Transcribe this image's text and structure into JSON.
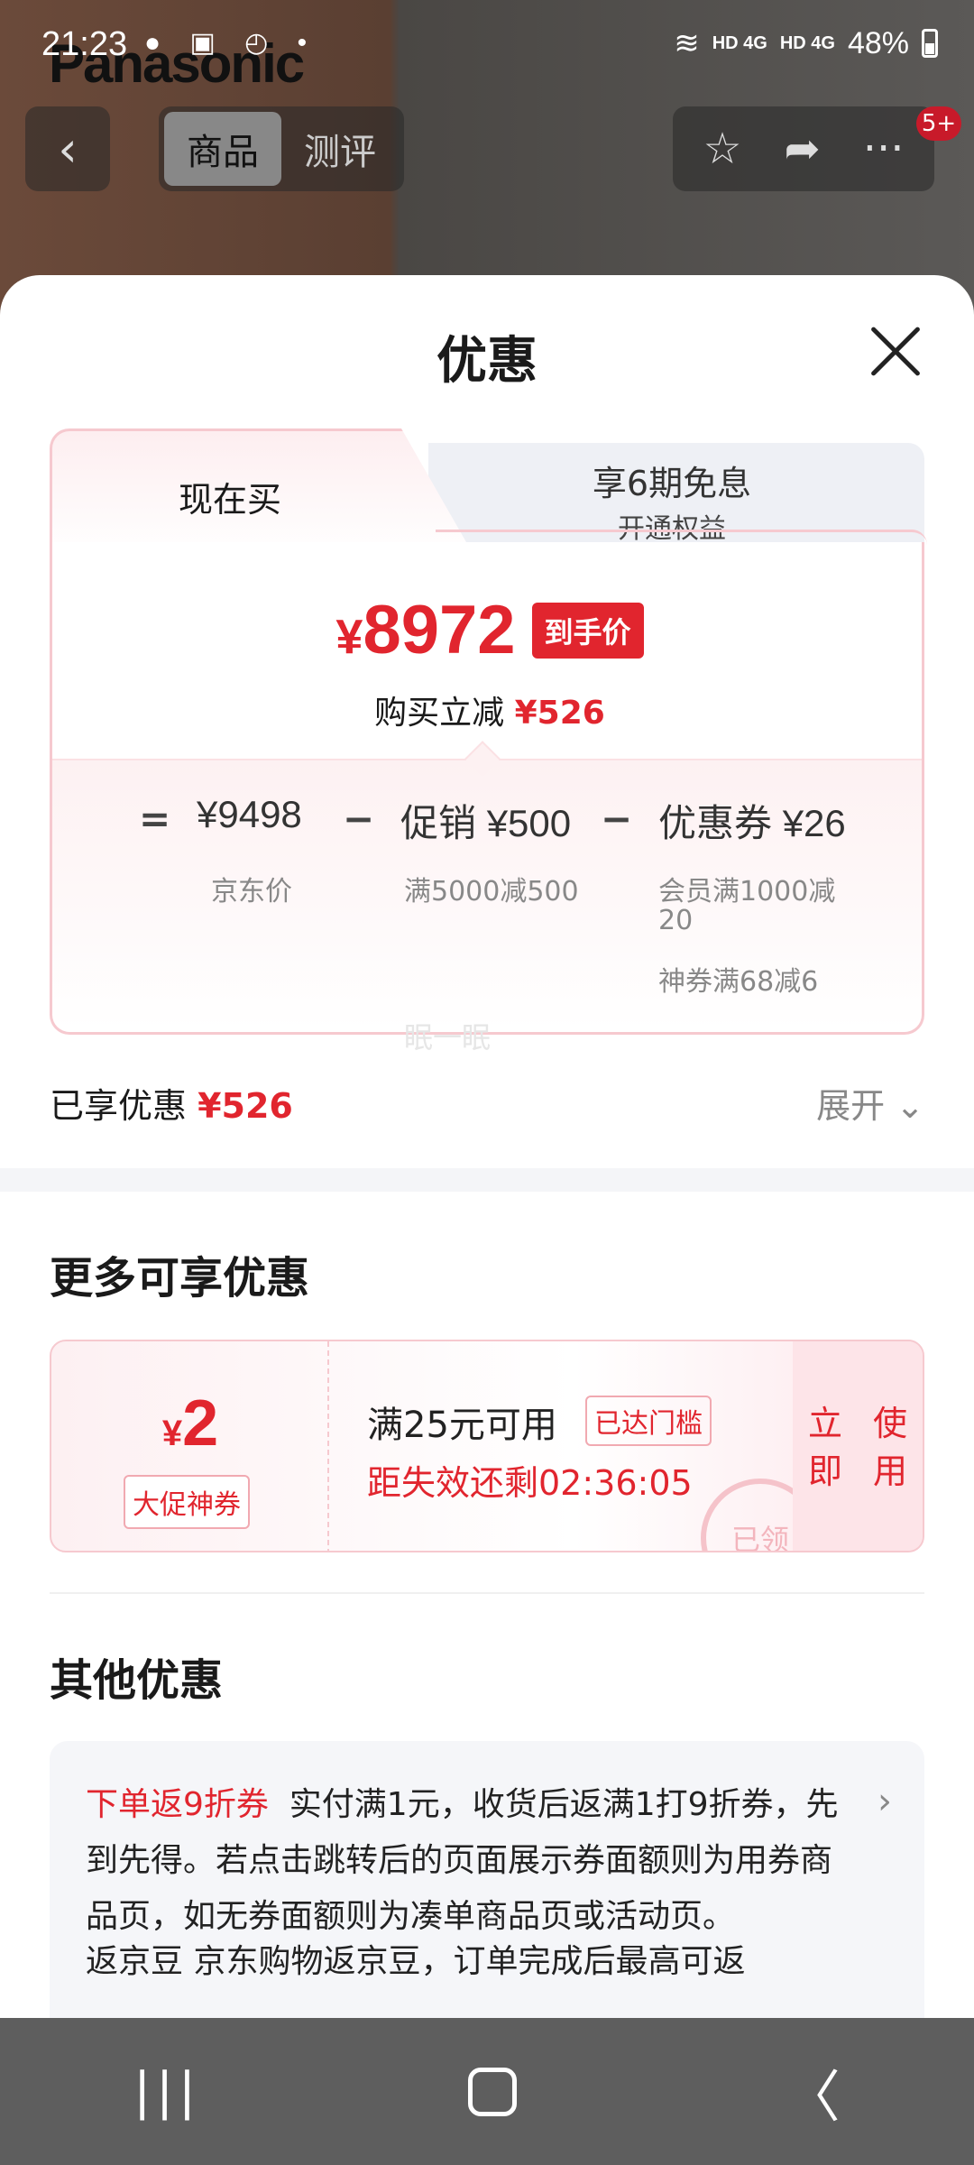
{
  "status_bar": {
    "time": "21:23",
    "notif_icons": "● ▣ ◴ •",
    "net1": "HD 4G",
    "net2": "HD 4G",
    "battery": "48%"
  },
  "background": {
    "brand": "Panasonic",
    "tabs": [
      "商品",
      "测评"
    ],
    "badge": "5+"
  },
  "sheet": {
    "title": "优惠",
    "tabs": [
      {
        "label": "现在买"
      },
      {
        "label": "享6期免息",
        "sub": "开通权益"
      }
    ],
    "final_price": {
      "currency": "¥",
      "value": "8972",
      "tag": "到手价"
    },
    "reduce": {
      "label": "购买立减",
      "amount": "¥526"
    },
    "breakdown": {
      "eq": "=",
      "jd_price": "¥9498",
      "jd_label": "京东价",
      "minus1": "−",
      "promo_label": "促销",
      "promo_value": "¥500",
      "promo_sub": "满5000减500",
      "minus2": "−",
      "coupon_label": "优惠券",
      "coupon_value": "¥26",
      "coupon_sub1": "会员满1000减",
      "coupon_sub1b": "20",
      "coupon_sub2": "神券满68减6"
    },
    "watermark": "眠一眠",
    "enjoyed_label": "已享优惠",
    "enjoyed_amount": "¥526",
    "expand": "展开 ⌄"
  },
  "more": {
    "title": "更多可享优惠",
    "coupon": {
      "currency": "¥",
      "amount": "2",
      "tag": "大促神券",
      "condition": "满25元可用",
      "reached": "已达门槛",
      "countdown": "距失效还剩02:36:05",
      "use_button": "立即使用",
      "stamp": "已领"
    }
  },
  "other": {
    "title": "其他优惠",
    "item1_tag": "下单返9折券",
    "item1_text": "实付满1元，收货后返满1打9折券，先到先得。若点击跳转后的页面展示券面额则为用券商品页，如无券面额则为凑单商品页或活动页。",
    "item2_partial": "返京豆 京东购物返京豆，订单完成后最高可返"
  },
  "nav": {
    "recent": "|||",
    "home": "",
    "back": "〈"
  }
}
